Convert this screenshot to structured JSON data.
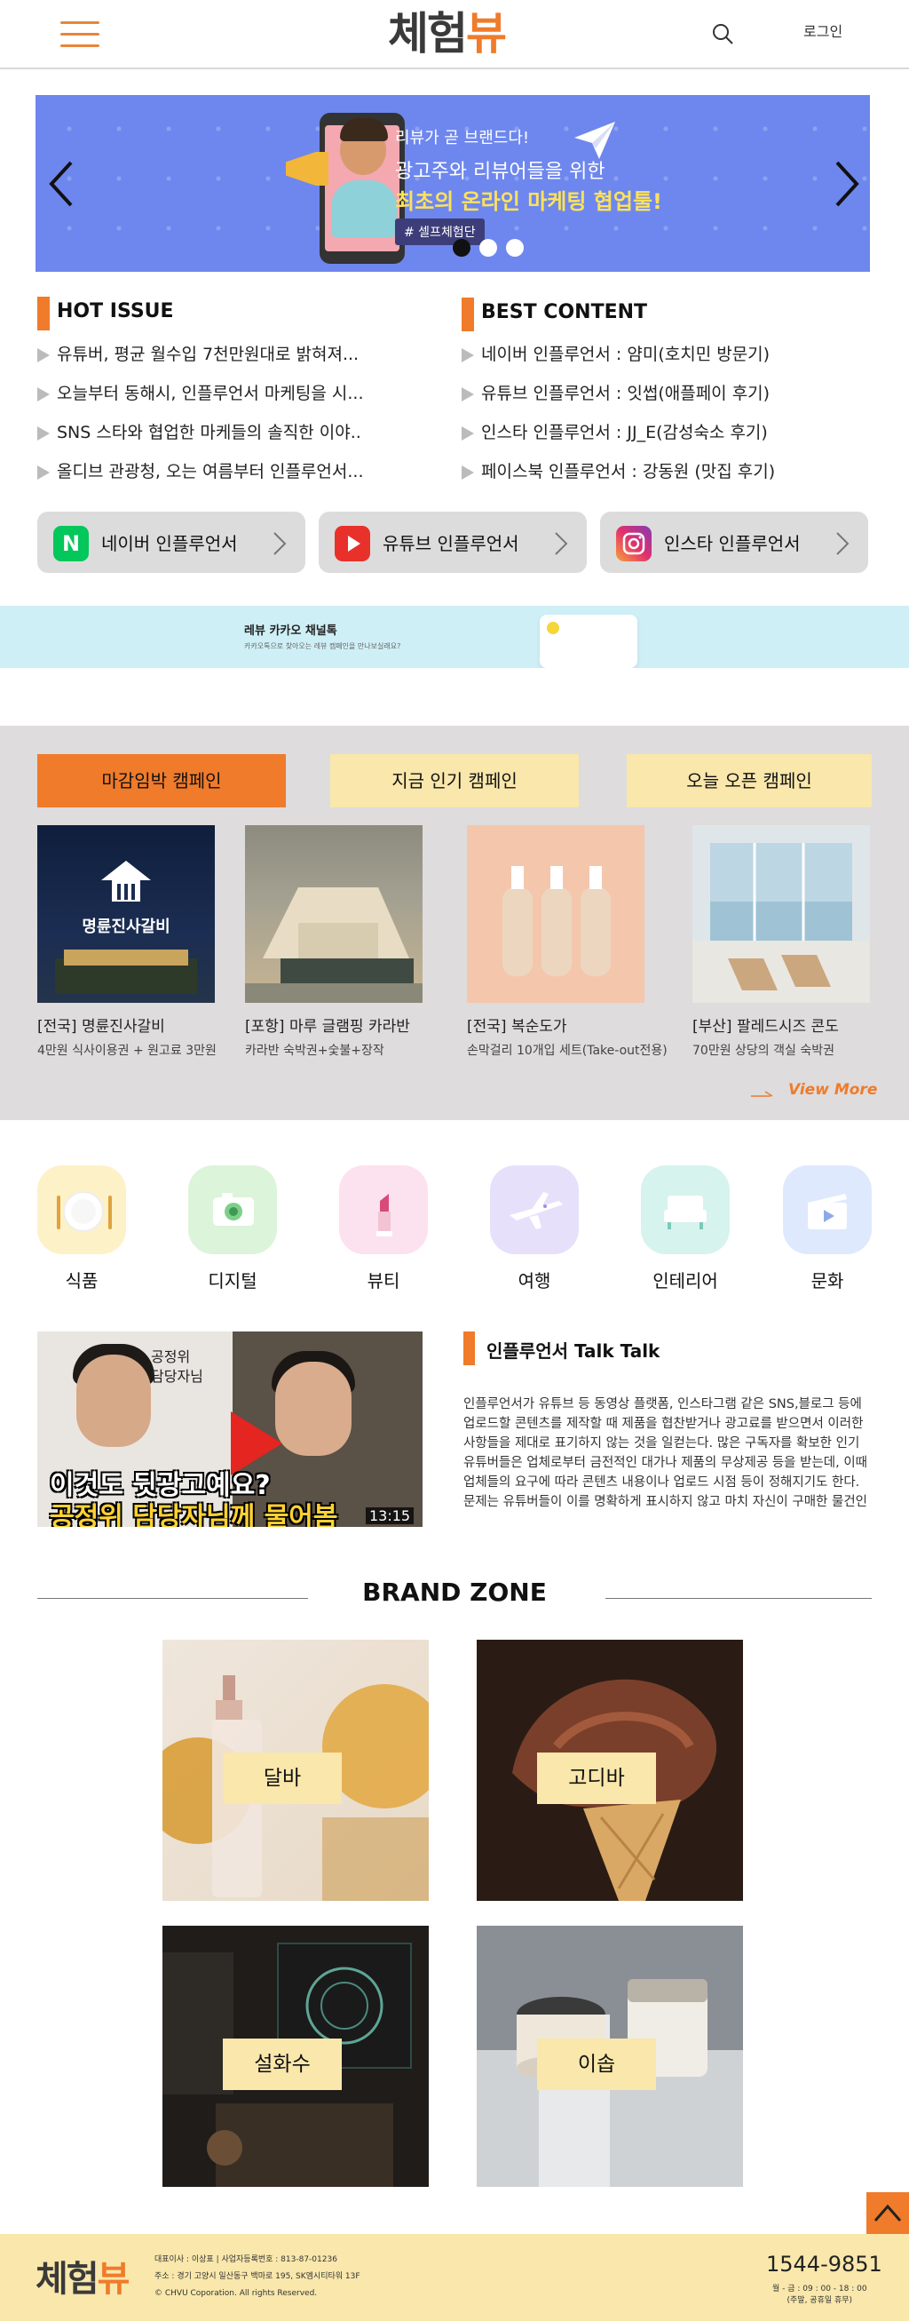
{
  "header": {
    "logo_part1": "체험",
    "logo_part2": "뷰",
    "login_label": "로그인"
  },
  "hero": {
    "line1": "리뷰가 곧 브랜드다!",
    "line2": "광고주와 리뷰어들을 위한",
    "line3": "최초의 온라인 마케팅 협업툴!",
    "tag": "# 셀프체험단",
    "slides": 3,
    "active_slide": 1
  },
  "hot_issue": {
    "title": "HOT ISSUE",
    "items": [
      "유튜버, 평균 월수입 7천만원대로 밝혀져...",
      "오늘부터 동해시, 인플루언서 마케팅을 시...",
      "SNS 스타와 협업한 마케들의 솔직한 이야..",
      "올디브 관광청, 오는 여름부터 인플루언서..."
    ]
  },
  "best_content": {
    "title": "BEST CONTENT",
    "items": [
      "네이버 인플루언서 : 얌미(호치민 방문기)",
      "유튜브 인플루언서 : 잇썹(애플페이 후기)",
      "인스타 인플루언서 : JJ_E(감성숙소 후기)",
      "페이스북 인플루언서 : 강동원 (맛집 후기)"
    ]
  },
  "influencer_buttons": [
    {
      "label": "네이버 인플루언서",
      "icon": "naver-icon",
      "color": "#03c75a"
    },
    {
      "label": "유튜브 인플루언서",
      "icon": "youtube-icon",
      "color": "#e8312a"
    },
    {
      "label": "인스타 인플루언서",
      "icon": "instagram-icon",
      "color": "#d6249f"
    }
  ],
  "kakao_banner": {
    "title": "레뷰 카카오 채널톡",
    "subtitle": "카카오톡으로 찾아오는 레뷰 캠페인을 만나보실래요?"
  },
  "campaign": {
    "tabs": [
      "마감임박 캠페인",
      "지금 인기 캠페인",
      "오늘 오픈 캠페인"
    ],
    "active_tab": 0,
    "cards": [
      {
        "title": "[전국] 명륜진사갈비",
        "sub": "4만원 식사이용권 + 원고료 3만원",
        "img_text": "명륜진사갈비"
      },
      {
        "title": "[포항] 마루 글램핑 카라반",
        "sub": "카라반 숙박권+숯불+장작"
      },
      {
        "title": "[전국] 복순도가",
        "sub": "손막걸리 10개입 세트(Take-out전용)"
      },
      {
        "title": "[부산] 팔레드시즈 콘도",
        "sub": "70만원 상당의 객실 숙박권"
      }
    ],
    "view_more": "View More"
  },
  "categories": [
    {
      "label": "식품",
      "icon": "plate-icon",
      "bg": "#fdf1c8"
    },
    {
      "label": "디지털",
      "icon": "camera-icon",
      "bg": "#dcf4da"
    },
    {
      "label": "뷰티",
      "icon": "lipstick-icon",
      "bg": "#fce1ee"
    },
    {
      "label": "여행",
      "icon": "airplane-icon",
      "bg": "#e7e0fb"
    },
    {
      "label": "인테리어",
      "icon": "sofa-icon",
      "bg": "#d6f3ee"
    },
    {
      "label": "문화",
      "icon": "clapperboard-icon",
      "bg": "#dfe9fd"
    }
  ],
  "video": {
    "caption1": "이것도 뒷광고예요?",
    "caption2": "공정위 담당자님께 물어봄",
    "note": "공정위\n담당자님",
    "duration": "13:15"
  },
  "talk": {
    "title": "인플루언서 Talk Talk",
    "body": "인플루언서가 유튜브 등 동영상 플랫폼, 인스타그램 같은 SNS,블로그 등에 업로드할 콘텐츠를 제작할 때 제품을 협찬받거나 광고료를 받으면서 이러한 사항들을 제대로 표기하지 않는 것을 일컫는다. 많은 구독자를 확보한 인기 유튜버들은 업체로부터 금전적인 대가나 제품의 무상제공 등을 받는데, 이때 업체들의 요구에 따라 콘텐츠 내용이나 업로드 시점 등이 정해지기도 한다. 문제는 유튜버들이 이를 명확하게 표시하지 않고 마치 자신이 구매한 물건인 것처럼 콘텐츠를 제작해 해당 상품을 광고한..."
  },
  "brand_zone": {
    "title": "BRAND ZONE",
    "brands": [
      "달바",
      "고디바",
      "설화수",
      "이솝"
    ]
  },
  "footer": {
    "logo_part1": "체험",
    "logo_part2": "뷰",
    "info_line1": "대표이사 : 이상표  |  사업자등록번호 : 813-87-01236",
    "info_line2": "주소 : 경기 고양시 일산동구 백마로 195, SK엠시티타워 13F",
    "info_line3": "© CHVU Coporation. All rights Reserved.",
    "phone": "1544-9851",
    "hours1": "월 - 금 : 09 : 00 - 18 : 00",
    "hours2": "(주말, 공휴일 휴무)"
  }
}
